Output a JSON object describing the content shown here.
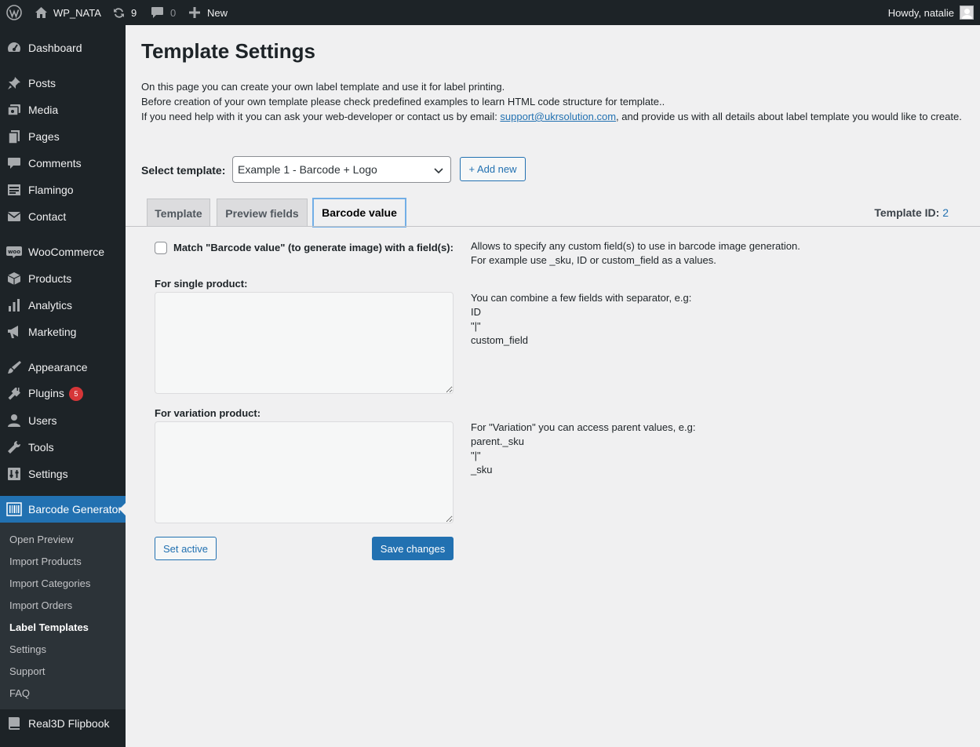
{
  "adminbar": {
    "site_name": "WP_NATA",
    "updates_count": "9",
    "comments_count": "0",
    "new_label": "New",
    "greeting": "Howdy, natalie"
  },
  "sidebar": {
    "items": [
      {
        "label": "Dashboard",
        "icon": "dashboard-icon"
      },
      {
        "label": "Posts",
        "icon": "pin-icon"
      },
      {
        "label": "Media",
        "icon": "media-icon"
      },
      {
        "label": "Pages",
        "icon": "pages-icon"
      },
      {
        "label": "Comments",
        "icon": "comments-icon"
      },
      {
        "label": "Flamingo",
        "icon": "flamingo-icon"
      },
      {
        "label": "Contact",
        "icon": "mail-icon"
      },
      {
        "label": "WooCommerce",
        "icon": "woo-icon"
      },
      {
        "label": "Products",
        "icon": "products-icon"
      },
      {
        "label": "Analytics",
        "icon": "analytics-icon"
      },
      {
        "label": "Marketing",
        "icon": "megaphone-icon"
      },
      {
        "label": "Appearance",
        "icon": "brush-icon"
      },
      {
        "label": "Plugins",
        "icon": "plugins-icon",
        "badge": "5"
      },
      {
        "label": "Users",
        "icon": "users-icon"
      },
      {
        "label": "Tools",
        "icon": "wrench-icon"
      },
      {
        "label": "Settings",
        "icon": "settings-icon"
      },
      {
        "label": "Barcode Generator",
        "icon": "barcode-icon"
      },
      {
        "label": "Real3D Flipbook",
        "icon": "book-icon"
      }
    ],
    "submenu": [
      "Open Preview",
      "Import Products",
      "Import Categories",
      "Import Orders",
      "Label Templates",
      "Settings",
      "Support",
      "FAQ"
    ]
  },
  "page": {
    "title": "Template Settings",
    "intro_line1": "On this page you can create your own label template and use it for label printing.",
    "intro_line2": "Before creation of your own template please check predefined examples to learn HTML code structure for template..",
    "intro_line3_pre": "If you need help with it you can ask your web-developer or contact us by email: ",
    "intro_email": "support@ukrsolution.com",
    "intro_line3_post": ", and provide us with all details about label template you would like to create.",
    "select_label": "Select template:",
    "select_value": "Example 1 - Barcode + Logo",
    "add_new_label": "+ Add new",
    "tabs": [
      "Template",
      "Preview fields",
      "Barcode value"
    ],
    "template_id_label": "Template ID:",
    "template_id_value": "2",
    "match_label": "Match \"Barcode value\" (to generate image) with a field(s):",
    "match_help_1": "Allows to specify any custom field(s) to use in barcode image generation.",
    "match_help_2": "For example use _sku, ID or custom_field as a values.",
    "single_label": "For single product:",
    "single_help": [
      "You can combine a few fields with separator, e.g:",
      "ID",
      "\"|\"",
      "custom_field"
    ],
    "variation_label": "For variation product:",
    "variation_help": [
      "For \"Variation\" you can access parent values, e.g:",
      "parent._sku",
      "\"|\"",
      "_sku"
    ],
    "set_active_label": "Set active",
    "save_label": "Save changes"
  }
}
